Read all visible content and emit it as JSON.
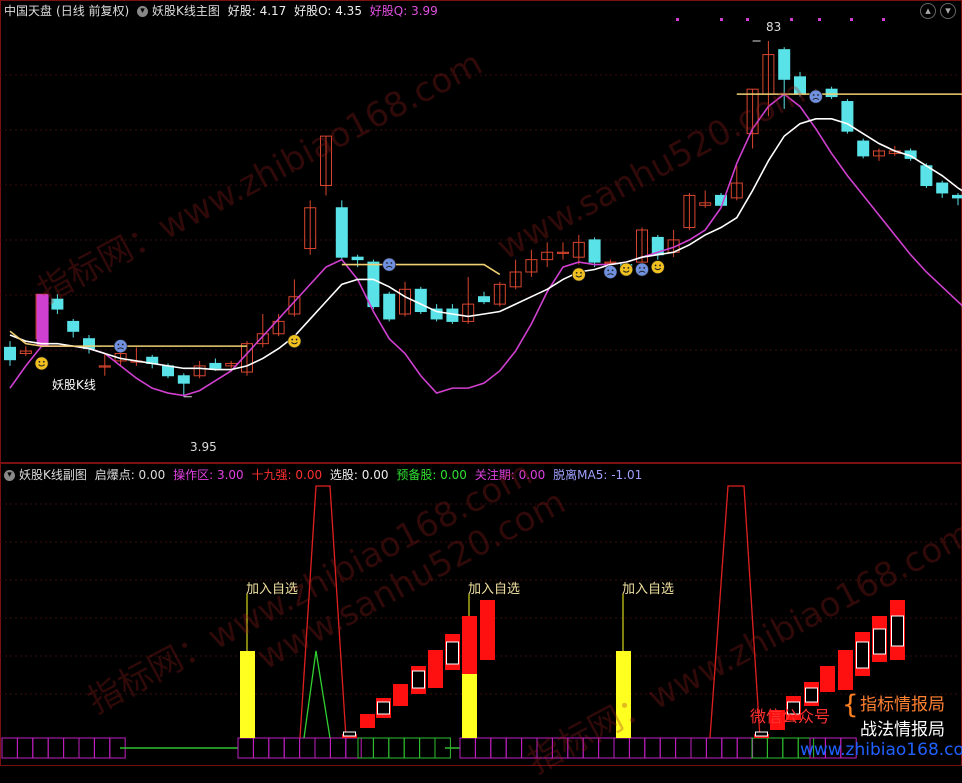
{
  "main_header": {
    "symbol": "中国天盘",
    "period": "(日线 前复权)",
    "indicator": "妖股K线主图",
    "hg_label": "好股: 4.17",
    "hgo_label": "好股O: 4.35",
    "hgq_label": "好股Q: 3.99"
  },
  "sub_header": {
    "indicator": "妖股K线副图",
    "qbd": "启爆点: 0.00",
    "czq": "操作区: 3.00",
    "sjq": "十九强: 0.00",
    "xg": "选股: 0.00",
    "ybg": "预备股: 0.00",
    "gzq": "关注期: 0.00",
    "tl": "脱离MA5: -1.01"
  },
  "annotations": {
    "high_price": "83",
    "low_price": "3.95",
    "yg_label": "妖股K线",
    "add_watch_1": "加入自选",
    "add_watch_2": "加入自选",
    "add_watch_3": "加入自选"
  },
  "watermarks": {
    "wm1": "指标网：www.zhibiao168.com",
    "wm2": "www.sanhu520.com",
    "wm3": "指标网：www.zhibiao168.com",
    "wm4": "www.sanhu520.com",
    "wm5": "指标网：www.zhibiao168.com",
    "wm6": "www.zhibiao168.com"
  },
  "branding": {
    "wechat": "微信公众号",
    "line1": "指标情报局",
    "line2": "战法情报局"
  },
  "colors": {
    "up": "#d9462f",
    "down": "#59e3e8",
    "ma_white": "#ffffff",
    "ma_yellow": "#f0d070",
    "ma_magenta": "#d040d0",
    "bar_yellow": "#ffff20",
    "bar_red": "#ff1010",
    "pulse_red": "#e02020",
    "pulse_green": "#30d030",
    "box_magenta": "#c020c0",
    "box_green": "#30c030"
  },
  "chart_data": {
    "type": "candlestick",
    "candles": [
      {
        "o": 4.35,
        "c": 4.25,
        "h": 4.4,
        "l": 4.2
      },
      {
        "o": 4.3,
        "c": 4.32,
        "h": 4.36,
        "l": 4.28
      },
      {
        "o": 4.42,
        "c": 4.78,
        "h": 4.78,
        "l": 4.4
      },
      {
        "o": 4.74,
        "c": 4.66,
        "h": 4.78,
        "l": 4.62
      },
      {
        "o": 4.56,
        "c": 4.48,
        "h": 4.58,
        "l": 4.43
      },
      {
        "o": 4.42,
        "c": 4.34,
        "h": 4.45,
        "l": 4.3
      },
      {
        "o": 4.2,
        "c": 4.2,
        "h": 4.3,
        "l": 4.12
      },
      {
        "o": 4.24,
        "c": 4.3,
        "h": 4.33,
        "l": 4.2
      },
      {
        "o": 4.24,
        "c": 4.24,
        "h": 4.35,
        "l": 4.2
      },
      {
        "o": 4.27,
        "c": 4.22,
        "h": 4.29,
        "l": 4.18
      },
      {
        "o": 4.2,
        "c": 4.12,
        "h": 4.22,
        "l": 4.1
      },
      {
        "o": 4.12,
        "c": 4.06,
        "h": 4.14,
        "l": 3.95
      },
      {
        "o": 4.12,
        "c": 4.2,
        "h": 4.24,
        "l": 4.1
      },
      {
        "o": 4.22,
        "c": 4.18,
        "h": 4.26,
        "l": 4.16
      },
      {
        "o": 4.2,
        "c": 4.22,
        "h": 4.24,
        "l": 4.18
      },
      {
        "o": 4.15,
        "c": 4.38,
        "h": 4.4,
        "l": 4.12
      },
      {
        "o": 4.38,
        "c": 4.46,
        "h": 4.62,
        "l": 4.35
      },
      {
        "o": 4.46,
        "c": 4.56,
        "h": 4.62,
        "l": 4.44
      },
      {
        "o": 4.62,
        "c": 4.76,
        "h": 4.9,
        "l": 4.6
      },
      {
        "o": 5.15,
        "c": 5.48,
        "h": 5.54,
        "l": 5.1
      },
      {
        "o": 5.66,
        "c": 6.06,
        "h": 6.06,
        "l": 5.58
      },
      {
        "o": 5.48,
        "c": 5.08,
        "h": 5.54,
        "l": 5.06
      },
      {
        "o": 5.08,
        "c": 5.06,
        "h": 5.1,
        "l": 5.0
      },
      {
        "o": 5.04,
        "c": 4.68,
        "h": 5.06,
        "l": 4.66
      },
      {
        "o": 4.78,
        "c": 4.58,
        "h": 4.8,
        "l": 4.56
      },
      {
        "o": 4.62,
        "c": 4.82,
        "h": 4.88,
        "l": 4.6
      },
      {
        "o": 4.82,
        "c": 4.64,
        "h": 4.84,
        "l": 4.62
      },
      {
        "o": 4.66,
        "c": 4.58,
        "h": 4.7,
        "l": 4.56
      },
      {
        "o": 4.66,
        "c": 4.56,
        "h": 4.7,
        "l": 4.54
      },
      {
        "o": 4.56,
        "c": 4.7,
        "h": 4.92,
        "l": 4.54
      },
      {
        "o": 4.76,
        "c": 4.72,
        "h": 4.8,
        "l": 4.7
      },
      {
        "o": 4.7,
        "c": 4.86,
        "h": 4.88,
        "l": 4.68
      },
      {
        "o": 4.84,
        "c": 4.96,
        "h": 5.06,
        "l": 4.82
      },
      {
        "o": 4.96,
        "c": 5.06,
        "h": 5.14,
        "l": 4.92
      },
      {
        "o": 5.06,
        "c": 5.12,
        "h": 5.2,
        "l": 5.0
      },
      {
        "o": 5.12,
        "c": 5.12,
        "h": 5.2,
        "l": 5.06
      },
      {
        "o": 5.08,
        "c": 5.2,
        "h": 5.26,
        "l": 5.02
      },
      {
        "o": 5.22,
        "c": 5.04,
        "h": 5.24,
        "l": 5.0
      },
      {
        "o": 5.04,
        "c": 5.04,
        "h": 5.06,
        "l": 5.0
      },
      {
        "o": 5.02,
        "c": 5.0,
        "h": 5.04,
        "l": 4.98
      },
      {
        "o": 5.04,
        "c": 5.3,
        "h": 5.32,
        "l": 5.02
      },
      {
        "o": 5.24,
        "c": 5.1,
        "h": 5.26,
        "l": 5.06
      },
      {
        "o": 5.12,
        "c": 5.22,
        "h": 5.3,
        "l": 5.08
      },
      {
        "o": 5.32,
        "c": 5.58,
        "h": 5.6,
        "l": 5.3
      },
      {
        "o": 5.5,
        "c": 5.52,
        "h": 5.62,
        "l": 5.48
      },
      {
        "o": 5.58,
        "c": 5.5,
        "h": 5.6,
        "l": 5.48
      },
      {
        "o": 5.56,
        "c": 5.68,
        "h": 5.82,
        "l": 5.54
      },
      {
        "o": 6.08,
        "c": 6.44,
        "h": 6.44,
        "l": 5.96
      },
      {
        "o": 6.4,
        "c": 6.72,
        "h": 6.83,
        "l": 6.22
      },
      {
        "o": 6.76,
        "c": 6.52,
        "h": 6.78,
        "l": 6.28
      },
      {
        "o": 6.54,
        "c": 6.4,
        "h": 6.58,
        "l": 6.38
      },
      {
        "o": 6.38,
        "c": 6.4,
        "h": 6.44,
        "l": 6.38
      },
      {
        "o": 6.44,
        "c": 6.38,
        "h": 6.46,
        "l": 6.36
      },
      {
        "o": 6.34,
        "c": 6.1,
        "h": 6.36,
        "l": 6.08
      },
      {
        "o": 6.02,
        "c": 5.9,
        "h": 6.04,
        "l": 5.88
      },
      {
        "o": 5.9,
        "c": 5.94,
        "h": 5.96,
        "l": 5.86
      },
      {
        "o": 5.92,
        "c": 5.94,
        "h": 5.98,
        "l": 5.9
      },
      {
        "o": 5.94,
        "c": 5.88,
        "h": 5.96,
        "l": 5.86
      },
      {
        "o": 5.82,
        "c": 5.66,
        "h": 5.84,
        "l": 5.64
      },
      {
        "o": 5.68,
        "c": 5.6,
        "h": 5.7,
        "l": 5.56
      },
      {
        "o": 5.58,
        "c": 5.56,
        "h": 5.6,
        "l": 5.5
      },
      {
        "o": 5.58,
        "c": 5.62,
        "h": 5.64,
        "l": 5.4
      }
    ],
    "ma_white": [
      4.45,
      4.4,
      4.38,
      4.38,
      4.36,
      4.34,
      4.3,
      4.26,
      4.24,
      4.22,
      4.2,
      4.18,
      4.18,
      4.17,
      4.17,
      4.2,
      4.26,
      4.34,
      4.44,
      4.58,
      4.72,
      4.86,
      4.9,
      4.9,
      4.84,
      4.76,
      4.7,
      4.64,
      4.62,
      4.6,
      4.62,
      4.64,
      4.7,
      4.76,
      4.82,
      4.9,
      4.96,
      4.98,
      5.02,
      5.04,
      5.08,
      5.1,
      5.12,
      5.18,
      5.26,
      5.32,
      5.4,
      5.62,
      5.86,
      6.06,
      6.16,
      6.2,
      6.2,
      6.16,
      6.08,
      6.0,
      5.94,
      5.9,
      5.82,
      5.74,
      5.64,
      5.56
    ],
    "ma_magenta": [
      4.02,
      4.2,
      4.36,
      4.36,
      4.36,
      4.34,
      4.3,
      4.2,
      4.1,
      4.02,
      3.98,
      3.96,
      4.0,
      4.08,
      4.16,
      4.3,
      4.44,
      4.58,
      4.72,
      4.86,
      5.0,
      5.06,
      4.9,
      4.64,
      4.42,
      4.3,
      4.12,
      3.98,
      4.02,
      4.02,
      4.06,
      4.16,
      4.32,
      4.54,
      4.8,
      5.0,
      5.04,
      5.02,
      5.02,
      5.04,
      5.08,
      5.12,
      5.16,
      5.22,
      5.3,
      5.48,
      5.84,
      6.12,
      6.3,
      6.4,
      6.3,
      6.12,
      5.92,
      5.74,
      5.58,
      5.42,
      5.26,
      5.1,
      4.96,
      4.84,
      4.72,
      4.6
    ],
    "ma_yellow_segments": [
      {
        "from": 0,
        "to": 15,
        "values": [
          4.48,
          4.38,
          4.36,
          4.36,
          4.36,
          4.36,
          4.36,
          4.36,
          4.36,
          4.36,
          4.36,
          4.36,
          4.36,
          4.36,
          4.36,
          4.36
        ]
      },
      {
        "from": 21,
        "to": 31,
        "values": [
          5.02,
          5.02,
          5.02,
          5.02,
          5.02,
          5.02,
          5.02,
          5.02,
          5.02,
          5.02,
          4.94
        ]
      },
      {
        "from": 46,
        "to": 61,
        "values": [
          6.4,
          6.4,
          6.4,
          6.4,
          6.4,
          6.4,
          6.4,
          6.4,
          6.4,
          6.4,
          6.4,
          6.4,
          6.4,
          6.4,
          6.4,
          6.4
        ]
      }
    ],
    "ylim": [
      3.6,
      7.0
    ]
  }
}
